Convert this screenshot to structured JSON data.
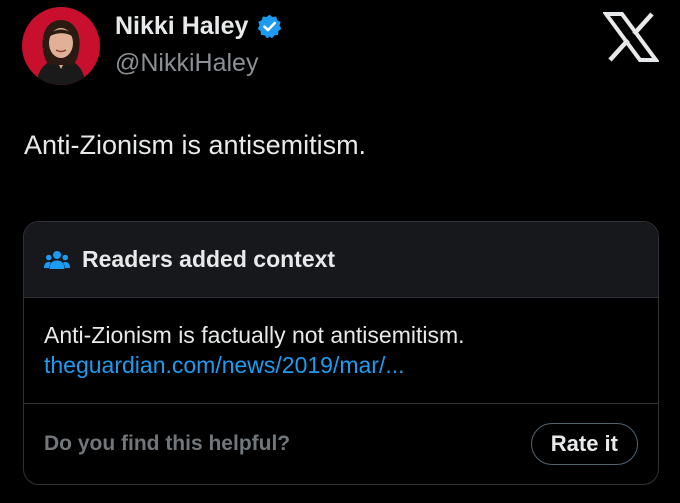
{
  "author": {
    "name": "Nikki Haley",
    "handle": "@NikkiHaley",
    "avatar_icon": "profile-photo",
    "verified_icon": "verified-badge-icon",
    "verified_color": "#1d9bf0"
  },
  "platform": {
    "logo_icon": "x-logo-icon"
  },
  "tweet": {
    "text": "Anti-Zionism is antisemitism."
  },
  "community_note": {
    "header_icon": "readers-icon",
    "header_title": "Readers added context",
    "body_text": "Anti-Zionism is factually not antisemitism.",
    "link_text": "theguardian.com/news/2019/mar/...",
    "helpful_question": "Do you find this helpful?",
    "rate_button_label": "Rate it"
  },
  "colors": {
    "background": "#000000",
    "text_primary": "#e7e9ea",
    "text_secondary": "#71767b",
    "link": "#1d9bf0",
    "border": "#2f3336"
  }
}
